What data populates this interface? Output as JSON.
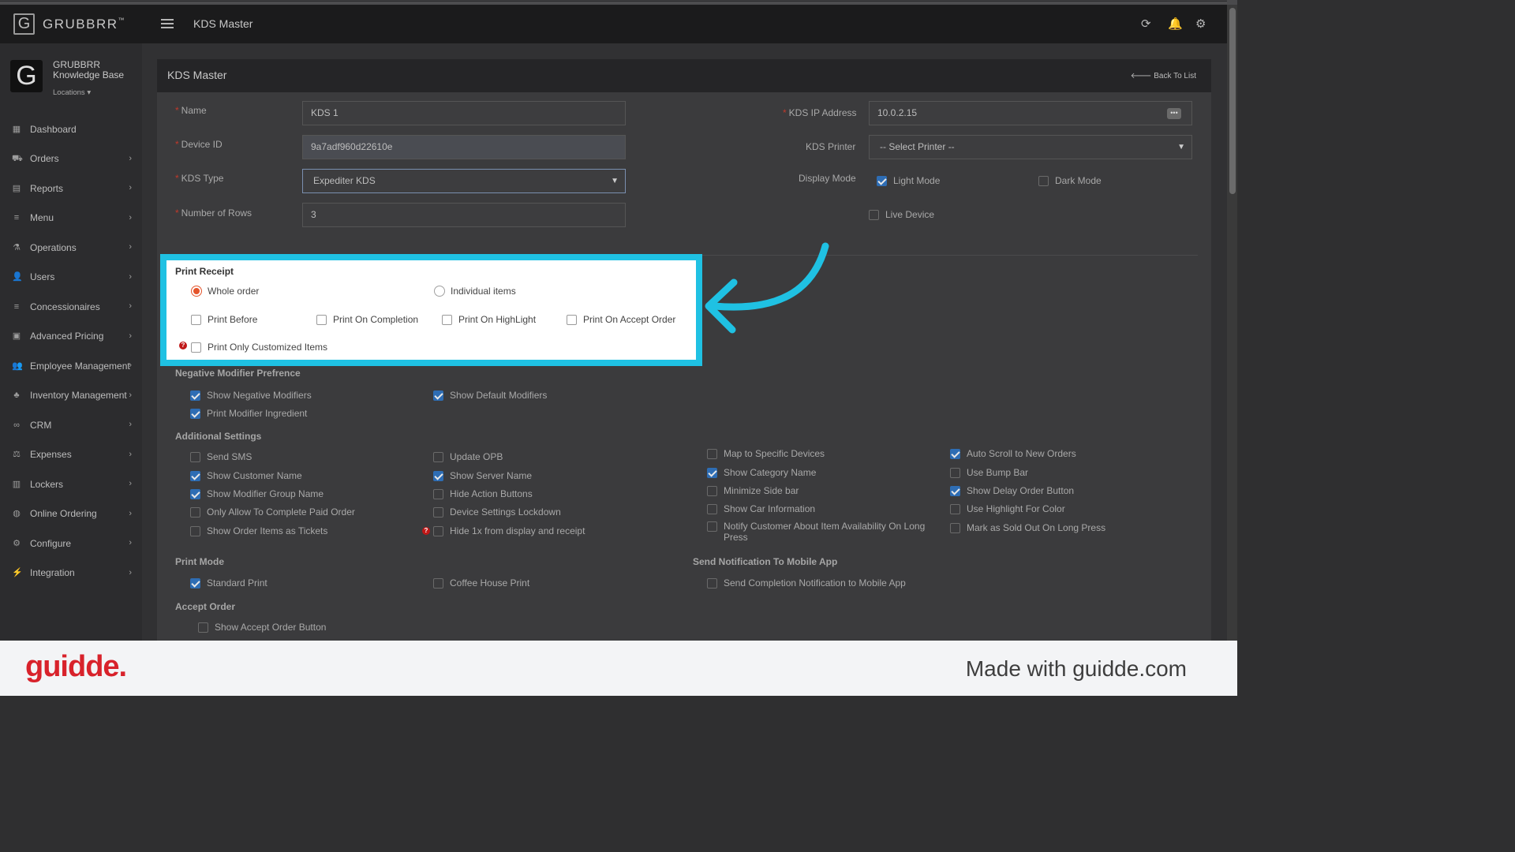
{
  "brand": {
    "logo_letter": "G",
    "name": "GRUBBRR",
    "tm": "™"
  },
  "profile": {
    "avatar_letter": "G",
    "line1": "GRUBBRR",
    "line2": "Knowledge Base",
    "locations": "Locations"
  },
  "nav": [
    {
      "label": "Dashboard",
      "icon": "dashboard-icon",
      "glyph": "▦",
      "chevron": ""
    },
    {
      "label": "Orders",
      "icon": "cart-icon",
      "glyph": "⛟",
      "chevron": "›"
    },
    {
      "label": "Reports",
      "icon": "file-icon",
      "glyph": "▤",
      "chevron": "›"
    },
    {
      "label": "Menu",
      "icon": "list-icon",
      "glyph": "≡",
      "chevron": "›"
    },
    {
      "label": "Operations",
      "icon": "flask-icon",
      "glyph": "⚗",
      "chevron": "›"
    },
    {
      "label": "Users",
      "icon": "user-plus-icon",
      "glyph": "👤",
      "chevron": "›"
    },
    {
      "label": "Concessionaires",
      "icon": "list-icon",
      "glyph": "≡",
      "chevron": "›"
    },
    {
      "label": "Advanced Pricing",
      "icon": "money-icon",
      "glyph": "▣",
      "chevron": "›"
    },
    {
      "label": "Employee Management",
      "icon": "users-icon",
      "glyph": "👥",
      "chevron": "›"
    },
    {
      "label": "Inventory Management",
      "icon": "sitemap-icon",
      "glyph": "♣",
      "chevron": "›"
    },
    {
      "label": "CRM",
      "icon": "link-icon",
      "glyph": "∞",
      "chevron": "›"
    },
    {
      "label": "Expenses",
      "icon": "scale-icon",
      "glyph": "⚖",
      "chevron": "›"
    },
    {
      "label": "Lockers",
      "icon": "locker-icon",
      "glyph": "▥",
      "chevron": "›"
    },
    {
      "label": "Online Ordering",
      "icon": "globe-icon",
      "glyph": "◍",
      "chevron": "›"
    },
    {
      "label": "Configure",
      "icon": "cog-icon",
      "glyph": "⚙",
      "chevron": "›"
    },
    {
      "label": "Integration",
      "icon": "plug-icon",
      "glyph": "⚡",
      "chevron": "›"
    }
  ],
  "header": {
    "title": "KDS Master",
    "refresh_glyph": "⟳",
    "bell_glyph": "🔔",
    "gear_glyph": "⚙"
  },
  "card": {
    "title": "KDS Master",
    "back": "🡐 Back To List"
  },
  "form": {
    "req": "*",
    "name_label": "Name",
    "name_value": "KDS 1",
    "device_label": "Device ID",
    "device_value": "9a7adf960d22610e",
    "type_label": "KDS Type",
    "type_value": "Expediter KDS",
    "rows_label": "Number of Rows",
    "rows_value": "3",
    "ip_label": "KDS IP Address",
    "ip_value": "10.0.2.15",
    "printer_label": "KDS Printer",
    "printer_value": "-- Select Printer --",
    "display_label": "Display Mode",
    "light_label": "Light Mode",
    "dark_label": "Dark Mode",
    "live_label": "Live Device"
  },
  "print_receipt": {
    "title": "Print Receipt",
    "whole_order": "Whole order",
    "individual_items": "Individual items",
    "print_before": "Print Before",
    "print_on_completion": "Print On Completion",
    "print_on_highlight": "Print On HighLight",
    "print_on_accept": "Print On Accept Order",
    "print_only_customized": "Print Only Customized Items"
  },
  "negative": {
    "title": "Negative Modifier Prefrence",
    "show_negative": "Show Negative Modifiers",
    "show_default": "Show Default Modifiers",
    "print_ingredient": "Print Modifier Ingredient"
  },
  "additional": {
    "title": "Additional Settings",
    "send_sms": "Send SMS",
    "update_opb": "Update OPB",
    "map_devices": "Map to Specific Devices",
    "auto_scroll": "Auto Scroll to New Orders",
    "customer_name": "Show Customer Name",
    "server_name": "Show Server Name",
    "category_name": "Show Category Name",
    "bump_bar": "Use Bump Bar",
    "modifier_group": "Show Modifier Group Name",
    "hide_action": "Hide Action Buttons",
    "minimize_side": "Minimize Side bar",
    "delay_order": "Show Delay Order Button",
    "only_paid": "Only Allow To Complete Paid Order",
    "device_lockdown": "Device Settings Lockdown",
    "car_info": "Show Car Information",
    "highlight_color": "Use Highlight For Color",
    "order_tickets": "Show Order Items as Tickets",
    "hide_1x": "Hide 1x from display and receipt",
    "notify_customer": "Notify Customer About Item Availability On Long Press",
    "sold_out": "Mark as Sold Out On Long Press"
  },
  "print_mode": {
    "title": "Print Mode",
    "standard": "Standard Print",
    "coffee": "Coffee House Print"
  },
  "notification": {
    "title": "Send Notification To Mobile App",
    "completion": "Send Completion Notification to Mobile App"
  },
  "accept_order": {
    "title": "Accept Order",
    "show_button": "Show Accept Order Button"
  },
  "footer": {
    "brand": "guidde.",
    "made_with": "Made with guidde.com"
  },
  "colors": {
    "highlight_border": "#1fc1e3",
    "arrow": "#1fc1e3",
    "checkbox_on": "#2e6db4",
    "radio_on": "#e4542b",
    "brand_red": "#d8222b"
  }
}
